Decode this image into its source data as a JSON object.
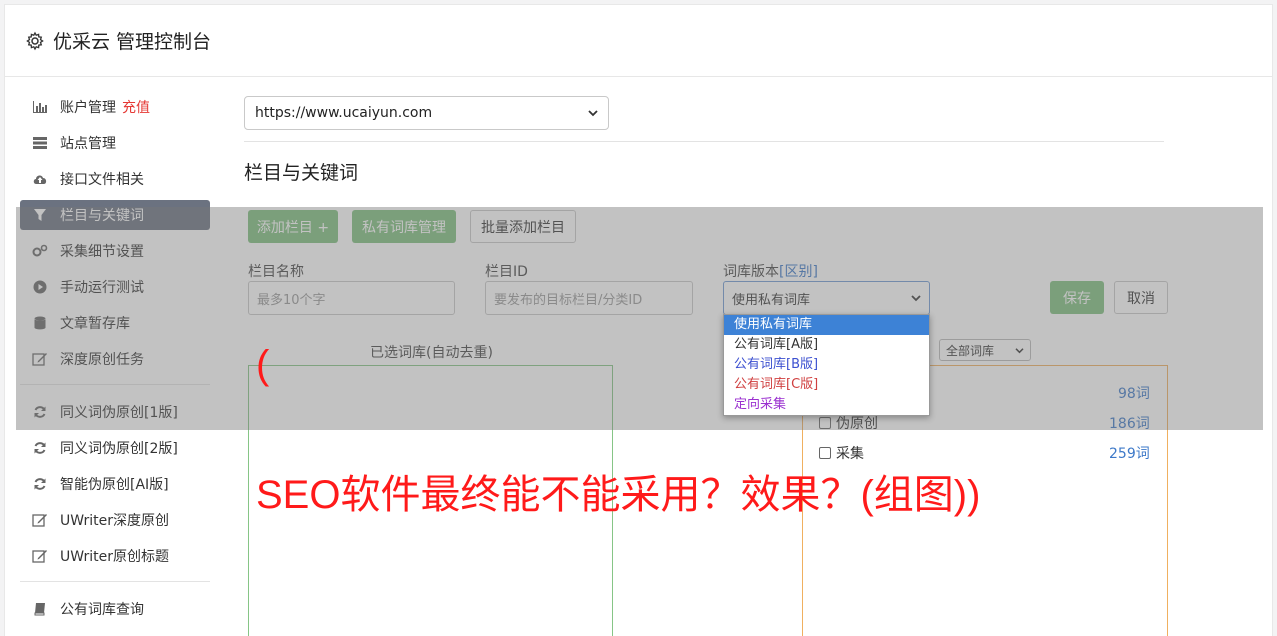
{
  "app": {
    "title": "优采云 管理控制台"
  },
  "sidebar": {
    "items": [
      {
        "label": "账户管理",
        "highlight": "充值",
        "icon": "bar-chart-icon"
      },
      {
        "label": "站点管理",
        "icon": "server-icon"
      },
      {
        "label": "接口文件相关",
        "icon": "cloud-upload-icon"
      },
      {
        "label": "栏目与关键词",
        "icon": "filter-icon",
        "active": true
      },
      {
        "label": "采集细节设置",
        "icon": "gears-icon"
      },
      {
        "label": "手动运行测试",
        "icon": "play-circle-icon"
      },
      {
        "label": "文章暂存库",
        "icon": "database-icon"
      },
      {
        "label": "深度原创任务",
        "icon": "edit-icon"
      },
      {
        "label": "同义词伪原创[1版]",
        "icon": "refresh-icon"
      },
      {
        "label": "同义词伪原创[2版]",
        "icon": "refresh-icon"
      },
      {
        "label": "智能伪原创[AI版]",
        "icon": "refresh-icon"
      },
      {
        "label": "UWriter深度原创",
        "icon": "edit-icon"
      },
      {
        "label": "UWriter原创标题",
        "icon": "edit-icon"
      },
      {
        "label": "公有词库查询",
        "icon": "book-icon"
      }
    ]
  },
  "main": {
    "site_select": "https://www.ucaiyun.com",
    "section_title": "栏目与关键词",
    "buttons": {
      "add": "添加栏目 +",
      "private_lib": "私有词库管理",
      "batch_add": "批量添加栏目",
      "save": "保存",
      "cancel": "取消"
    },
    "form": {
      "name_label": "栏目名称",
      "name_placeholder": "最多10个字",
      "id_label": "栏目ID",
      "id_placeholder": "要发布的目标栏目/分类ID",
      "lib_label": "词库版本",
      "lib_label_link": "[区别]",
      "lib_value": "使用私有词库"
    },
    "selected_title": "已选词库(自动去重)",
    "filter_select": "全部词库",
    "libraries": [
      {
        "label": "伪原创",
        "count": "186词"
      },
      {
        "label": "采集",
        "count": "259词"
      }
    ],
    "top_count": "98词",
    "dropdown_options": [
      {
        "label": "使用私有词库",
        "color": "#ffffff",
        "selected": true
      },
      {
        "label": "公有词库[A版]",
        "color": "#333333"
      },
      {
        "label": "公有词库[B版]",
        "color": "#3c50d0"
      },
      {
        "label": "公有词库[C版]",
        "color": "#d04040"
      },
      {
        "label": "定向采集",
        "color": "#9b30d0"
      }
    ]
  },
  "watermark": {
    "paren": "(",
    "text": "SEO软件最终能不能采用？效果？(组图))"
  }
}
